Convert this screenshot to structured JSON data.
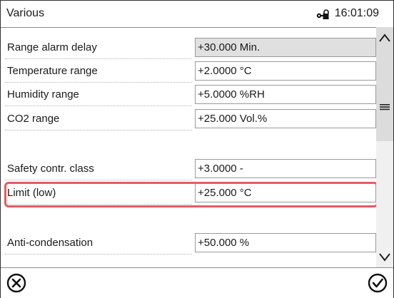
{
  "header": {
    "title": "Various",
    "time": "16:01:09",
    "lock_icon": "lock-key-icon"
  },
  "rows": [
    {
      "label": "Range alarm delay",
      "value": "+30.000 Min.",
      "readonly": true
    },
    {
      "label": "Temperature range",
      "value": "+2.0000 °C"
    },
    {
      "label": "Humidity range",
      "value": "+5.0000 %RH"
    },
    {
      "label": "CO2 range",
      "value": "+25.000 Vol.%"
    },
    {
      "label": "Safety contr. class",
      "value": "+3.0000 -"
    },
    {
      "label": "Limit (low)",
      "value": "+25.000 °C",
      "highlighted": true
    },
    {
      "label": "Anti-condensation",
      "value": "+50.000 %"
    }
  ],
  "scrollbar": {
    "up_icon": "chevron-up-icon",
    "down_icon": "chevron-down-icon",
    "menu_icon": "menu-icon"
  },
  "footer": {
    "cancel_icon": "cancel-circle-icon",
    "ok_icon": "check-circle-icon"
  },
  "colors": {
    "highlight": "#e85a62",
    "readonly_field": "#e0e0e0",
    "scroll_track": "#f0f0f0"
  }
}
